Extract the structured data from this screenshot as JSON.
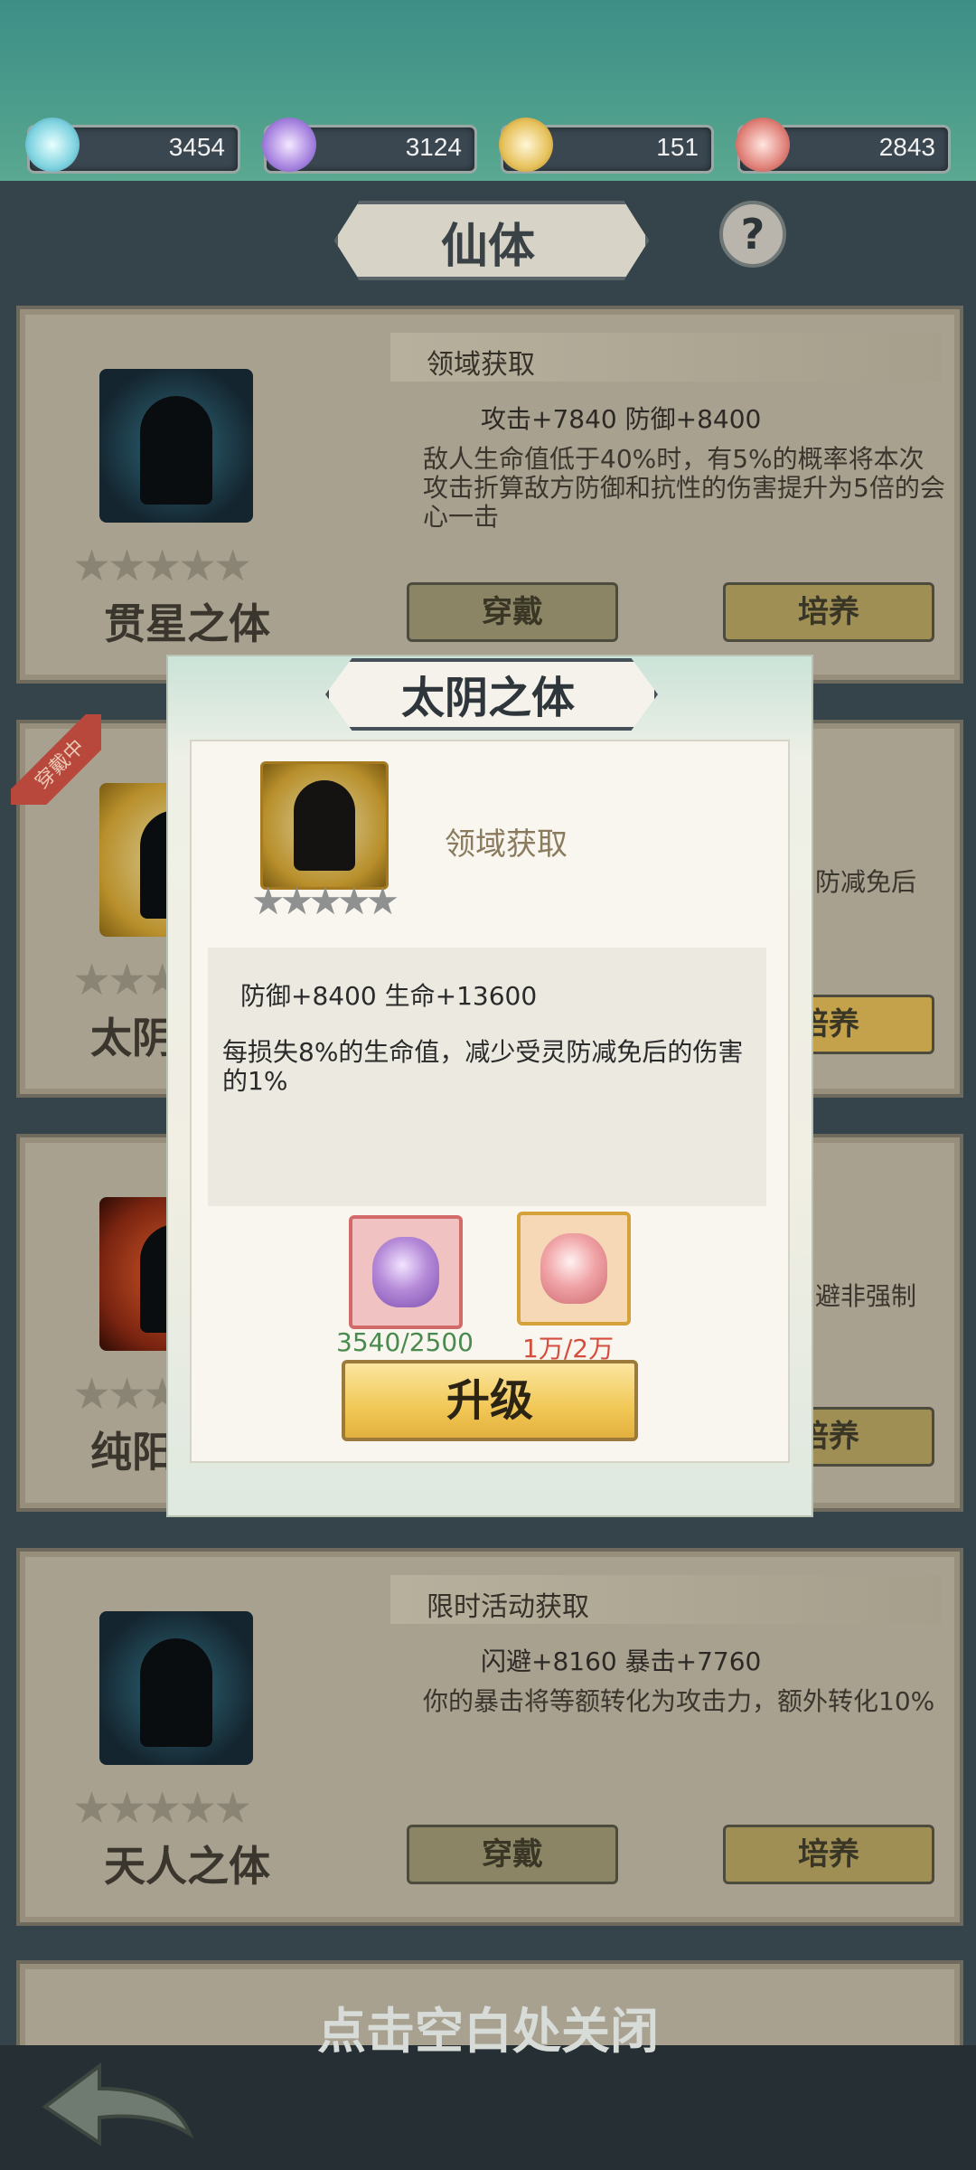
{
  "resources": [
    {
      "icon": "cyan-gourd-icon",
      "value": "3454"
    },
    {
      "icon": "purple-gourd-icon",
      "value": "3124"
    },
    {
      "icon": "gold-gourd-icon",
      "value": "151"
    },
    {
      "icon": "red-gourd-icon",
      "value": "2843"
    }
  ],
  "page_title": "仙体",
  "help_label": "?",
  "cards": [
    {
      "source": "领域获取",
      "stats": "攻击+7840 防御+8400",
      "desc": "敌人生命值低于40%时，有5%的概率将本次攻击折算敌方防御和抗性的伤害提升为5倍的会心一击",
      "name": "贯星之体",
      "equip_label": "穿戴",
      "train_label": "培养"
    },
    {
      "badge": "穿戴中",
      "name_partial": "太阴",
      "desc_partial": "防减免后",
      "train_partial": "培养"
    },
    {
      "name_partial": "纯阳",
      "desc_partial": "避非强制",
      "train_partial": "培养"
    },
    {
      "source": "限时活动获取",
      "stats": "闪避+8160 暴击+7760",
      "desc": "你的暴击将等额转化为攻击力，额外转化10%",
      "name": "天人之体",
      "equip_label": "穿戴",
      "train_label": "培养"
    }
  ],
  "dialog": {
    "title": "太阴之体",
    "source": "领域获取",
    "stats": "防御+8400 生命+13600",
    "desc": "每损失8%的生命值，减少受灵防减免后的伤害的1%",
    "cost1": "3540/2500",
    "cost2": "1万/2万",
    "upgrade_label": "升级"
  },
  "close_hint": "点击空白处关闭",
  "colors": {
    "cost_ok": "#4a8a4e",
    "cost_lack": "#d54d3c",
    "upgrade_button": "#f1c856"
  }
}
